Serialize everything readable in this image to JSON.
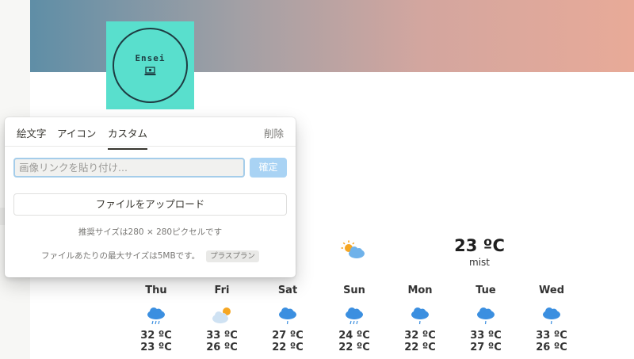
{
  "page_icon": {
    "logo_text": "Ensei",
    "icon": "laptop-icon",
    "bg_color": "#59dfcd"
  },
  "weather": {
    "current": {
      "icon": "sun-behind-cloud-icon",
      "temp": "23 ºC",
      "desc": "mist"
    },
    "days": [
      {
        "name": "Thu",
        "icon": "rain-cloud-icon",
        "hi": "32 ºC",
        "lo": "23 ºC"
      },
      {
        "name": "Fri",
        "icon": "sun-behind-cloud-icon",
        "hi": "33 ºC",
        "lo": "26 ºC"
      },
      {
        "name": "Sat",
        "icon": "drizzle-cloud-icon",
        "hi": "27 ºC",
        "lo": "22 ºC"
      },
      {
        "name": "Sun",
        "icon": "rain-cloud-icon",
        "hi": "24 ºC",
        "lo": "22 ºC"
      },
      {
        "name": "Mon",
        "icon": "drizzle-cloud-icon",
        "hi": "32 ºC",
        "lo": "22 ºC"
      },
      {
        "name": "Tue",
        "icon": "drizzle-cloud-icon",
        "hi": "33 ºC",
        "lo": "27 ºC"
      },
      {
        "name": "Wed",
        "icon": "drizzle-cloud-icon",
        "hi": "33 ºC",
        "lo": "26 ºC"
      }
    ]
  },
  "popover": {
    "tabs": [
      {
        "label": "絵文字",
        "active": false
      },
      {
        "label": "アイコン",
        "active": false
      },
      {
        "label": "カスタム",
        "active": true
      }
    ],
    "remove_label": "削除",
    "url_input": {
      "placeholder": "画像リンクを貼り付け...",
      "value": ""
    },
    "confirm_label": "確定",
    "upload_label": "ファイルをアップロード",
    "recommended_size": "推奨サイズは280 × 280ピクセルです",
    "max_size": "ファイルあたりの最大サイズは5MBです。",
    "plan_badge": "プラスプラン"
  }
}
